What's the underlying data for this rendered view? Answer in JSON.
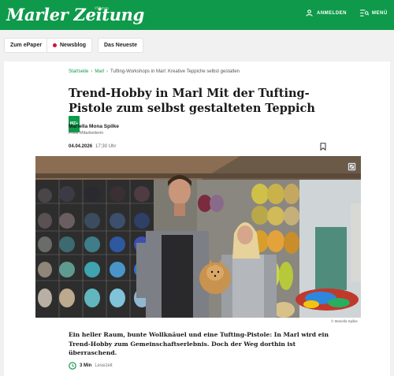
{
  "header": {
    "logo": "Marler Zeitung",
    "logo_tag": "#Mongo",
    "login_label": "ANMELDEN",
    "menu_label": "MENÜ"
  },
  "pills": {
    "epaper": "Zum ePaper",
    "newsblog": "Newsblog",
    "latest": "Das Neueste"
  },
  "breadcrumb": {
    "home": "Startseite",
    "section": "Marl",
    "current": "Tufting-Workshops in Marl: Kreative Teppiche selbst gestalten"
  },
  "article": {
    "kicker": "Trend-Hobby in Marl",
    "title": "Mit der Tufting-Pistole zum selbst gestalteten Teppich",
    "badge": "MZ+",
    "author": "Mariella Mona Spilke",
    "author_role": "Freie Mitarbeiterin",
    "date": "04.04.2026",
    "time": "17:30 Uhr",
    "photo_credit": "© Mariella Spilke",
    "teaser": "Ein heller Raum, bunte Wollknäuel und eine Tufting-Pistole: In Marl wird ein Trend-Hobby zum Gemeinschaftserlebnis. Doch der Weg dorthin ist überraschend.",
    "read_minutes": "3 Min",
    "read_label": "Lesezeit"
  },
  "colors": {
    "brand_green": "#0e9a4a",
    "live_red": "#d3103f"
  }
}
